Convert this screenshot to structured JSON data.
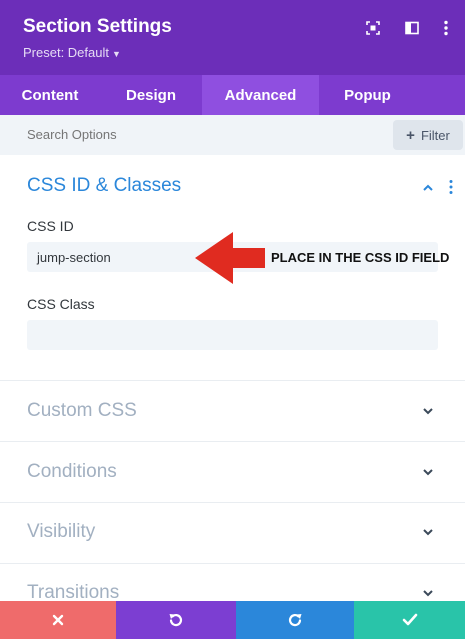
{
  "header": {
    "title": "Section Settings",
    "preset_label": "Preset: Default",
    "icons": [
      "expand-icon",
      "sidebar-toggle-icon",
      "more-options-icon"
    ],
    "bg_color": "#6c2eb9"
  },
  "tabs": [
    {
      "label": "Content",
      "active": false
    },
    {
      "label": "Design",
      "active": false
    },
    {
      "label": "Advanced",
      "active": true
    },
    {
      "label": "Popup",
      "active": false
    }
  ],
  "search": {
    "placeholder": "Search Options",
    "filter_label": "Filter"
  },
  "css_section": {
    "title": "CSS ID & Classes",
    "title_color": "#2b87da",
    "css_id_label": "CSS ID",
    "css_id_value": "jump-section",
    "css_class_label": "CSS Class",
    "css_class_value": ""
  },
  "annotation": {
    "text": "PLACE IN THE CSS ID FIELD",
    "arrow_color": "#e02b20"
  },
  "collapsed_sections": [
    {
      "title": "Custom CSS"
    },
    {
      "title": "Conditions"
    },
    {
      "title": "Visibility"
    },
    {
      "title": "Transitions"
    }
  ],
  "footer": {
    "buttons": [
      {
        "name": "discard-button",
        "icon": "close-icon",
        "color": "#ef6b6b"
      },
      {
        "name": "undo-button",
        "icon": "undo-icon",
        "color": "#7c3ed2"
      },
      {
        "name": "redo-button",
        "icon": "redo-icon",
        "color": "#2b87da"
      },
      {
        "name": "save-button",
        "icon": "check-icon",
        "color": "#29c4a9"
      }
    ]
  }
}
